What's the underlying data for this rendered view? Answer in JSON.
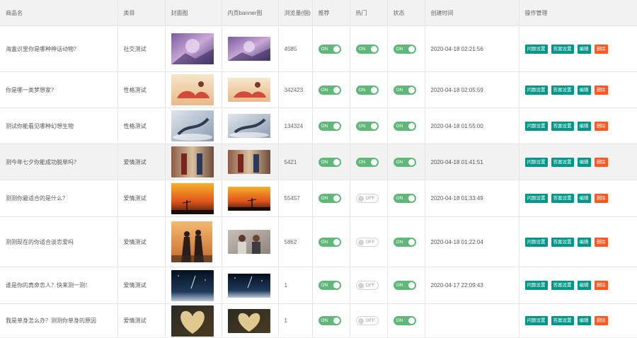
{
  "headers": {
    "name": "商品名",
    "category": "类目",
    "cover": "封面图",
    "banner": "内页banner图",
    "views": "浏览量(個)",
    "recommend": "推荐",
    "hot": "热门",
    "status": "状态",
    "created": "创建时间",
    "actions": "操作管理"
  },
  "labels": {
    "on": "ON",
    "off": "OFF"
  },
  "buttons": {
    "question": "问题设置",
    "answer": "答案设置",
    "edit": "编辑",
    "delete": "删除"
  },
  "colors": {
    "on": "#5fb878",
    "btn": "#009688",
    "delete": "#ff5722"
  },
  "rows": [
    {
      "name": "海盒识里你是哪种神话动物？",
      "category": "社交测试",
      "views": "4585",
      "recommend": true,
      "hot": true,
      "status": true,
      "created": "2020-04-18 02:21:56",
      "answer_label": "答案设置"
    },
    {
      "name": "你是哪一类梦想家？",
      "category": "性格测试",
      "views": "342423",
      "recommend": true,
      "hot": true,
      "status": true,
      "created": "2020-04-18 02:05:59",
      "answer_label": "答案设置"
    },
    {
      "name": "测试你能看见哪种幻想生物",
      "category": "性格测试",
      "views": "134324",
      "recommend": true,
      "hot": true,
      "status": true,
      "created": "2020-04-18 01:55:00",
      "answer_label": "答案设置"
    },
    {
      "name": "测今年七夕你能成功脱单吗？",
      "category": "爱情测试",
      "views": "5421",
      "recommend": true,
      "hot": true,
      "status": true,
      "created": "2020-04-18 01:41:51",
      "answer_label": "答案设置"
    },
    {
      "name": "测测你最适合的是什么？",
      "category": "爱情测试",
      "views": "55457",
      "recommend": true,
      "hot": false,
      "status": true,
      "created": "2020-04-18 01:33:49",
      "answer_label": "答案设置"
    },
    {
      "name": "测测现在的你适合谈恋爱吗",
      "category": "爱情测试",
      "views": "5862",
      "recommend": true,
      "hot": false,
      "status": true,
      "created": "2020-04-18 01:22:04",
      "answer_label": "答案设置"
    },
    {
      "name": "谁是你的真命恋人？快来测一测！",
      "category": "爱情测试",
      "views": "1",
      "recommend": true,
      "hot": false,
      "status": true,
      "created": "2020-04-17 22:09:43",
      "answer_label": "答案设置"
    },
    {
      "name": "我是单身怎么办？测测你单身的原因",
      "category": "爱情测试",
      "views": "1",
      "recommend": true,
      "hot": false,
      "status": true,
      "created": "",
      "answer_label": "答案设置"
    }
  ]
}
